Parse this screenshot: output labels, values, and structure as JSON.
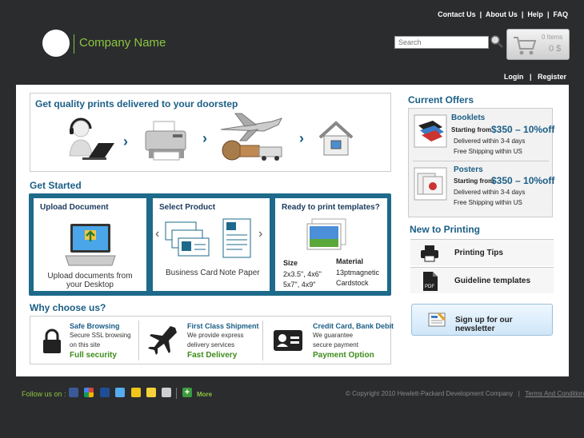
{
  "header": {
    "links": [
      "Contact Us",
      "About Us",
      "Help",
      "FAQ"
    ],
    "company_name": "Company Name",
    "search_placeholder": "Search",
    "cart_items": "0 Items",
    "cart_total": "0 $",
    "login": "Login",
    "register": "Register"
  },
  "delivery": {
    "title": "Get quality prints delivered to your doorstep"
  },
  "get_started": {
    "title": "Get Started",
    "upload": {
      "title": "Upload Document",
      "caption": "Upload documents from your Desktop"
    },
    "select": {
      "title": "Select Product",
      "business_card": "Business Card",
      "note_paper": "Note Paper"
    },
    "templates": {
      "title": "Ready to print templates?",
      "size_label": "Size",
      "size_line1": "2x3.5\", 4x6\"",
      "size_line2": "5x7\", 4x9\"",
      "material_label": "Material",
      "material_line1": "13ptmagnetic",
      "material_line2": "Cardstock"
    }
  },
  "why": {
    "title": "Why choose us?",
    "items": [
      {
        "title": "Safe Browsing",
        "line1": "Secure SSL browsing",
        "line2": "on this site",
        "tagline": "Full security"
      },
      {
        "title": "First Class Shipment",
        "line1": "We provide express",
        "line2": "delivery services",
        "tagline": "Fast Delivery"
      },
      {
        "title": "Credit Card, Bank Debit",
        "line1": "We guarantee",
        "line2": "secure payment",
        "tagline": "Payment Option"
      }
    ]
  },
  "offers": {
    "title": "Current Offers",
    "items": [
      {
        "title": "Booklets",
        "from": "Starting from",
        "price": "$350 – 10%off",
        "line1": "Delivered within 3-4 days",
        "line2": "Free Shipping within US"
      },
      {
        "title": "Posters",
        "from": "Starting from",
        "price": "$350 – 10%off",
        "line1": "Delivered within 3-4 days",
        "line2": "Free Shipping within US"
      }
    ]
  },
  "new_to_printing": {
    "title": "New to Printing",
    "tips": "Printing Tips",
    "guidelines": "Guideline templates"
  },
  "newsletter": "Sign up for our newsletter",
  "footer": {
    "follow": "Follow us on :",
    "more": "More",
    "copyright": "© Copyright 2010 Hewlett-Packard Development Company",
    "terms": "Terms And Conditions"
  },
  "colors": {
    "brand_green": "#8cc63f",
    "brand_blue": "#1b5e86",
    "background": "#2b2c2e"
  },
  "social_icons": [
    "facebook-icon",
    "google-icon",
    "myspace-icon",
    "twitter-icon",
    "email-icon",
    "star-icon",
    "print-icon"
  ]
}
